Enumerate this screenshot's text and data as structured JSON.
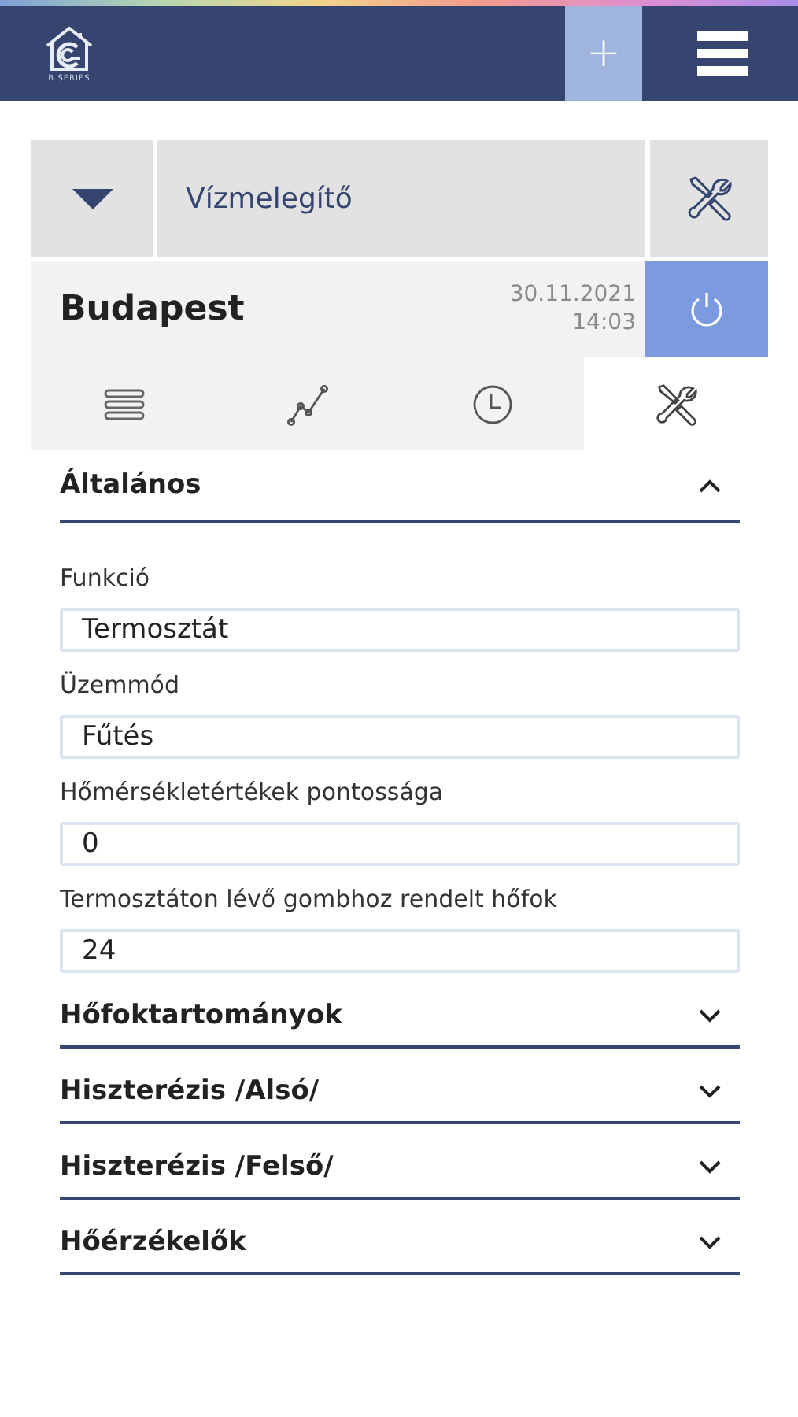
{
  "header": {
    "logo_text": "B SERIES",
    "add_label": "+"
  },
  "device": {
    "name": "Vízmelegítő"
  },
  "location": {
    "name": "Budapest",
    "date": "30.11.2021",
    "time": "14:03"
  },
  "tabs": [
    {
      "kind": "list",
      "selected": false
    },
    {
      "kind": "chart",
      "selected": false
    },
    {
      "kind": "clock",
      "selected": false
    },
    {
      "kind": "tools",
      "selected": true
    }
  ],
  "sections": [
    {
      "title": "Általános",
      "expanded": true,
      "fields": [
        {
          "label": "Funkció",
          "value": "Termosztát"
        },
        {
          "label": "Üzemmód",
          "value": "Fűtés"
        },
        {
          "label": "Hőmérsékletértékek pontossága",
          "value": "0"
        },
        {
          "label": "Termosztáton lévő gombhoz rendelt hőfok",
          "value": "24"
        }
      ]
    },
    {
      "title": "Hőfoktartományok",
      "expanded": false
    },
    {
      "title": "Hiszterézis /Alsó/",
      "expanded": false
    },
    {
      "title": "Hiszterézis /Felső/",
      "expanded": false
    },
    {
      "title": "Hőérzékelők",
      "expanded": false
    }
  ]
}
